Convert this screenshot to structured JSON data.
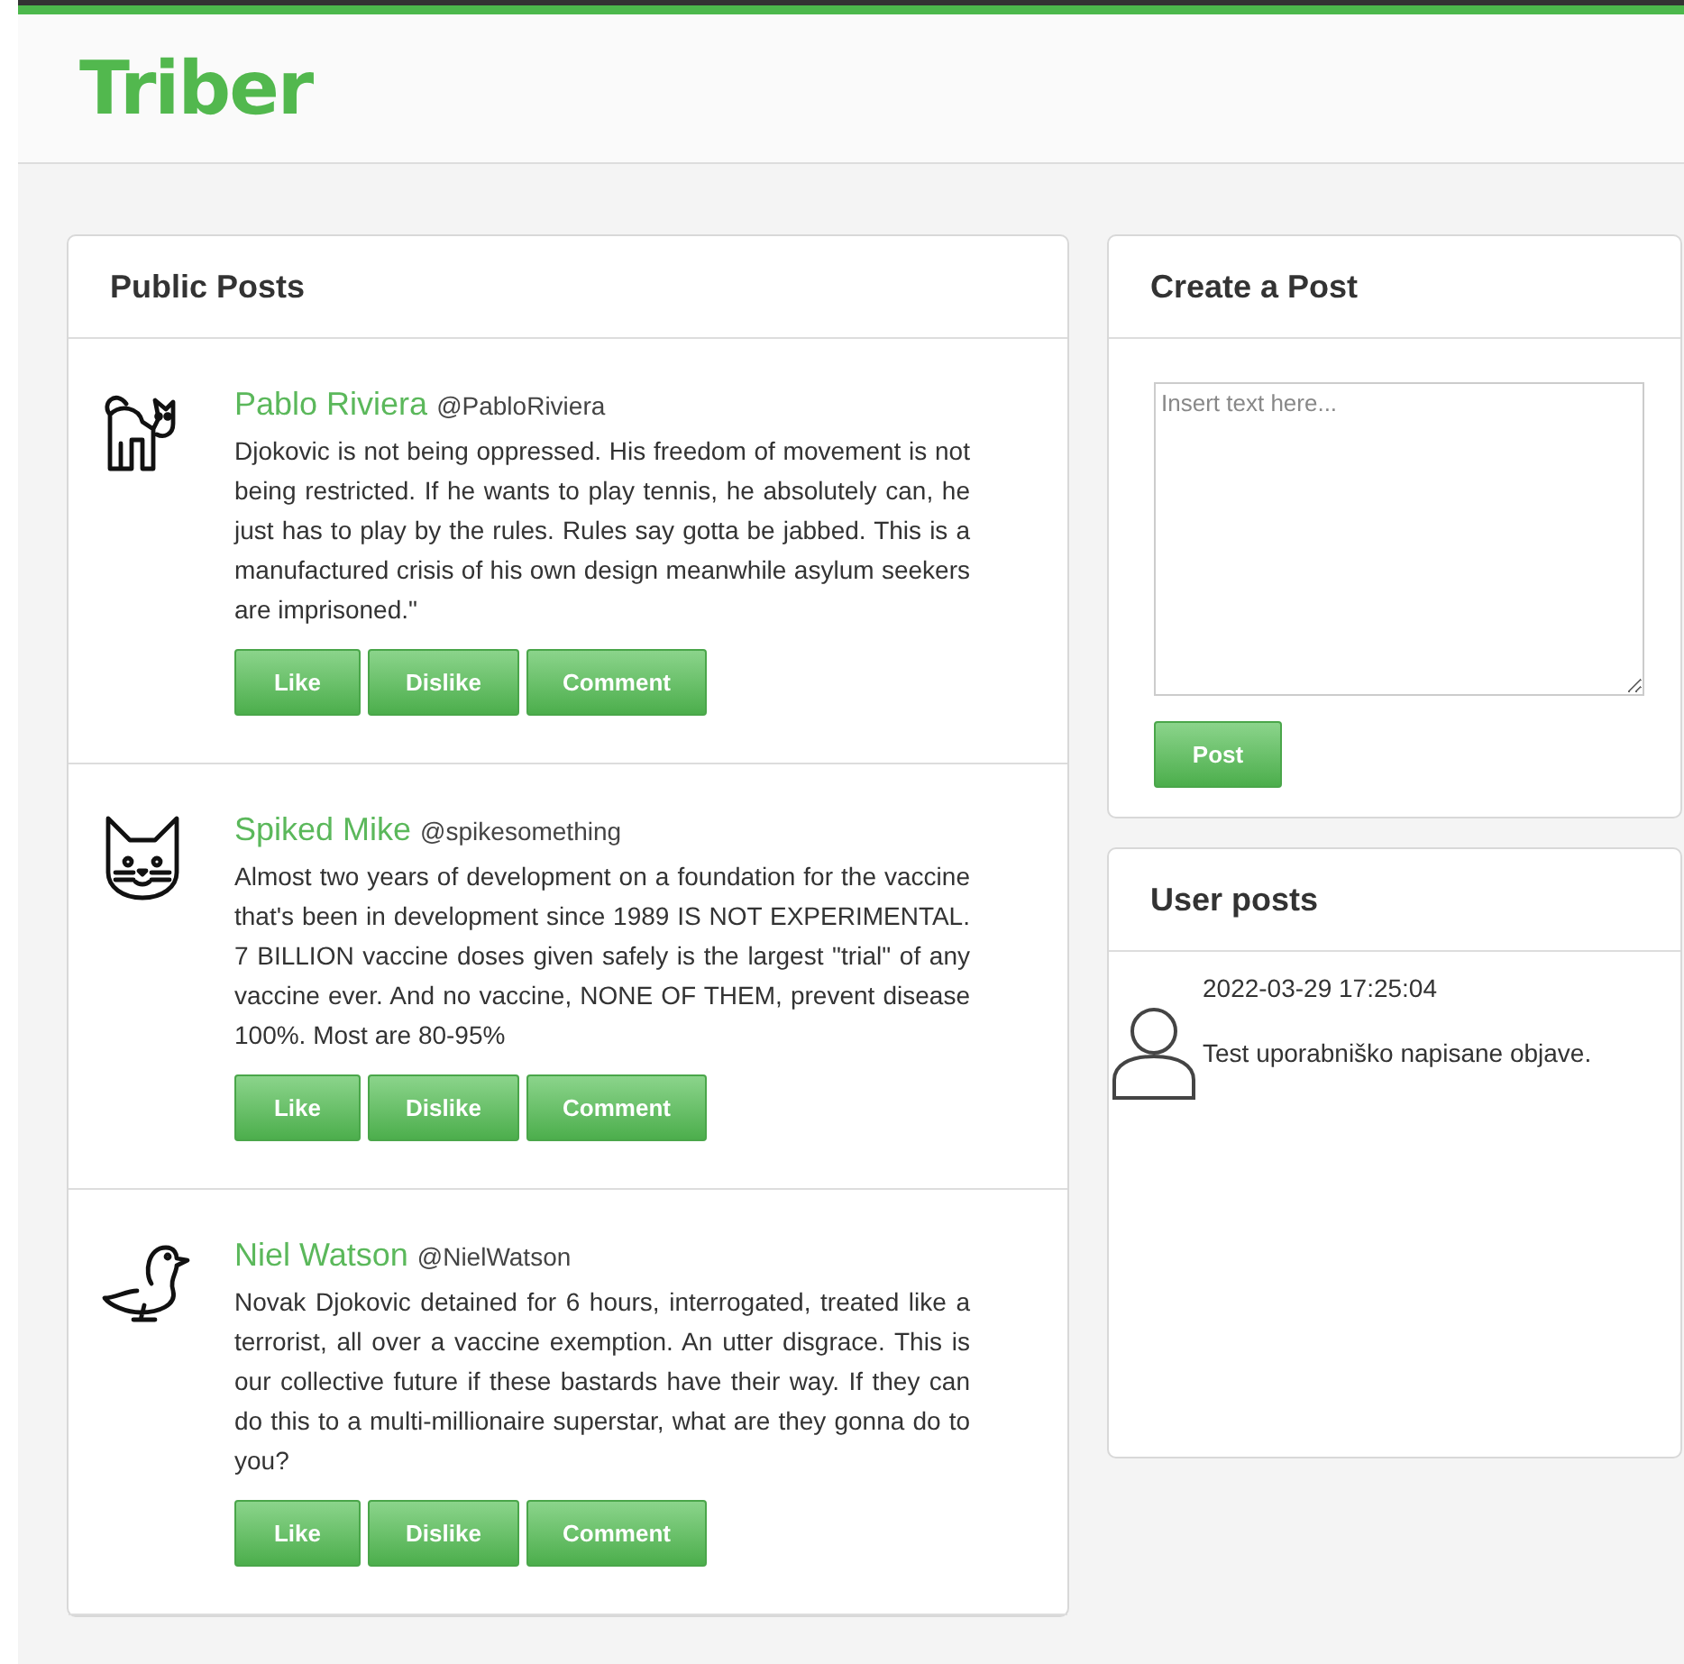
{
  "logo": "Triber",
  "public_posts": {
    "title": "Public Posts",
    "posts": [
      {
        "name": "Pablo Riviera",
        "handle": "@PabloRiviera",
        "text": "Djokovic is not being oppressed. His freedom of movement is not being restricted. If he wants to play tennis, he absolutely can, he just has to play by the rules. Rules say gotta be jabbed. This is a manufactured crisis of his own design meanwhile asylum seekers are imprisoned.\"",
        "buttons": [
          "Like",
          "Dislike",
          "Comment"
        ]
      },
      {
        "name": "Spiked Mike",
        "handle": "@spikesomething",
        "text": "Almost two years of development on a foundation for the vaccine that's been in development since 1989 IS NOT EXPERIMENTAL. 7 BILLION vaccine doses given safely is the largest \"trial\" of any vaccine ever. And no vaccine, NONE OF THEM, prevent disease 100%. Most are 80-95%",
        "buttons": [
          "Like",
          "Dislike",
          "Comment"
        ]
      },
      {
        "name": "Niel Watson",
        "handle": "@NielWatson",
        "text": "Novak Djokovic detained for 6 hours, interrogated, treated like a terrorist, all over a vaccine exemption. An utter disgrace. This is our collective future if these bastards have their way. If they can do this to a multi-millionaire superstar, what are they gonna do to you?",
        "buttons": [
          "Like",
          "Dislike",
          "Comment"
        ]
      }
    ]
  },
  "create_post": {
    "title": "Create a Post",
    "placeholder": "Insert text here...",
    "button": "Post"
  },
  "user_posts": {
    "title": "User posts",
    "posts": [
      {
        "date": "2022-03-29 17:25:04",
        "text": "Test uporabniško napisane objave."
      }
    ]
  }
}
